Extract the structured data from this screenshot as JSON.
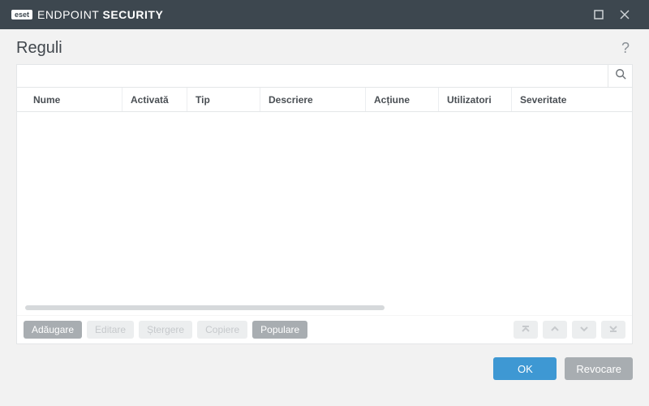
{
  "titlebar": {
    "logo_text": "eset",
    "product_light": "ENDPOINT ",
    "product_bold": "SECURITY"
  },
  "page": {
    "title": "Reguli"
  },
  "search": {
    "value": "",
    "placeholder": ""
  },
  "columns": [
    "Nume",
    "Activată",
    "Tip",
    "Descriere",
    "Acțiune",
    "Utilizatori",
    "Severitate"
  ],
  "rows": [],
  "toolbar": {
    "add": "Adăugare",
    "edit": "Editare",
    "delete": "Ștergere",
    "copy": "Copiere",
    "populate": "Populare"
  },
  "footer": {
    "ok": "OK",
    "cancel": "Revocare"
  },
  "help": "?"
}
